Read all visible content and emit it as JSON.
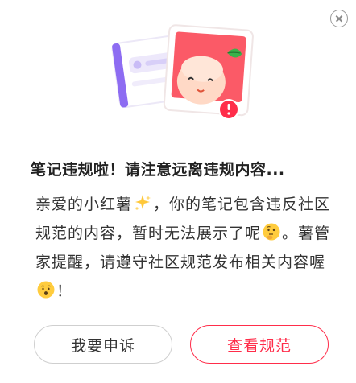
{
  "dialog": {
    "title": "笔记违规啦！请注意远离违规内容...",
    "body": {
      "seg1": "亲爱的小红薯",
      "seg2": "，你的笔记包含违反社区规范的内容，暂时无法展示了呢",
      "seg3": "。薯管家提醒，请遵守社区规范发布相关内容喔",
      "seg4": "！"
    },
    "buttons": {
      "appeal_label": "我要申诉",
      "view_rules_label": "查看规范"
    },
    "colors": {
      "accent": "#ff2d4a",
      "title": "#222222",
      "body": "#333333"
    },
    "icons": [
      "close-icon",
      "sparkle-emoji",
      "thinking-face-emoji",
      "surprised-face-emoji",
      "warning-icon"
    ]
  }
}
